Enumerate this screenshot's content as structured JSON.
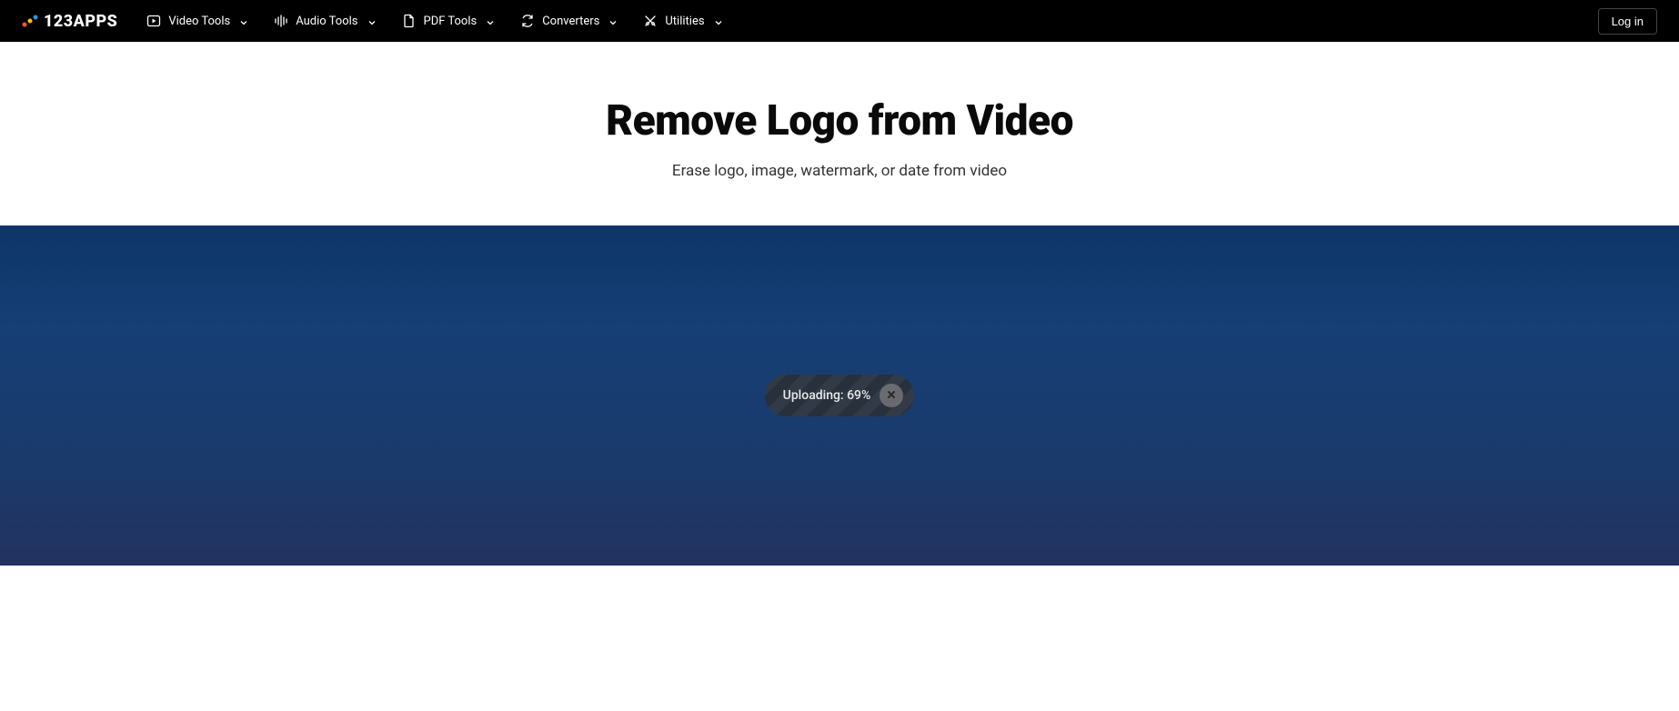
{
  "header": {
    "logo_text": "123APPS",
    "nav": [
      {
        "label": "Video Tools",
        "icon": "play-square-icon"
      },
      {
        "label": "Audio Tools",
        "icon": "audio-wave-icon"
      },
      {
        "label": "PDF Tools",
        "icon": "file-icon"
      },
      {
        "label": "Converters",
        "icon": "convert-icon"
      },
      {
        "label": "Utilities",
        "icon": "tools-icon"
      }
    ],
    "login_label": "Log in"
  },
  "main": {
    "title": "Remove Logo from Video",
    "subtitle": "Erase logo, image, watermark, or date from video"
  },
  "upload": {
    "status_text": "Uploading: 69%"
  }
}
